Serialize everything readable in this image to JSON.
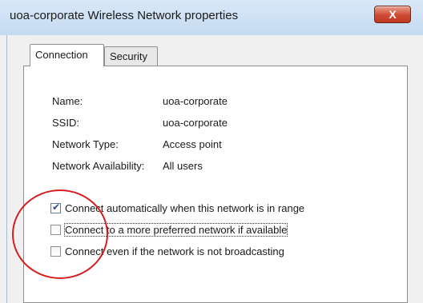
{
  "window": {
    "title": "uoa-corporate Wireless Network properties",
    "close_label": "X"
  },
  "tabs": [
    {
      "label": "Connection",
      "active": true
    },
    {
      "label": "Security",
      "active": false
    }
  ],
  "properties": [
    {
      "label": "Name:",
      "value": "uoa-corporate"
    },
    {
      "label": "SSID:",
      "value": "uoa-corporate"
    },
    {
      "label": "Network Type:",
      "value": "Access point"
    },
    {
      "label": "Network Availability:",
      "value": "All users"
    }
  ],
  "options": [
    {
      "label": "Connect automatically when this network is in range",
      "checked": true
    },
    {
      "label": "Connect to a more preferred network if available",
      "checked": false
    },
    {
      "label": "Connect even if the network is not broadcasting",
      "checked": false
    }
  ],
  "annotation": {
    "color": "#d51f1f"
  }
}
